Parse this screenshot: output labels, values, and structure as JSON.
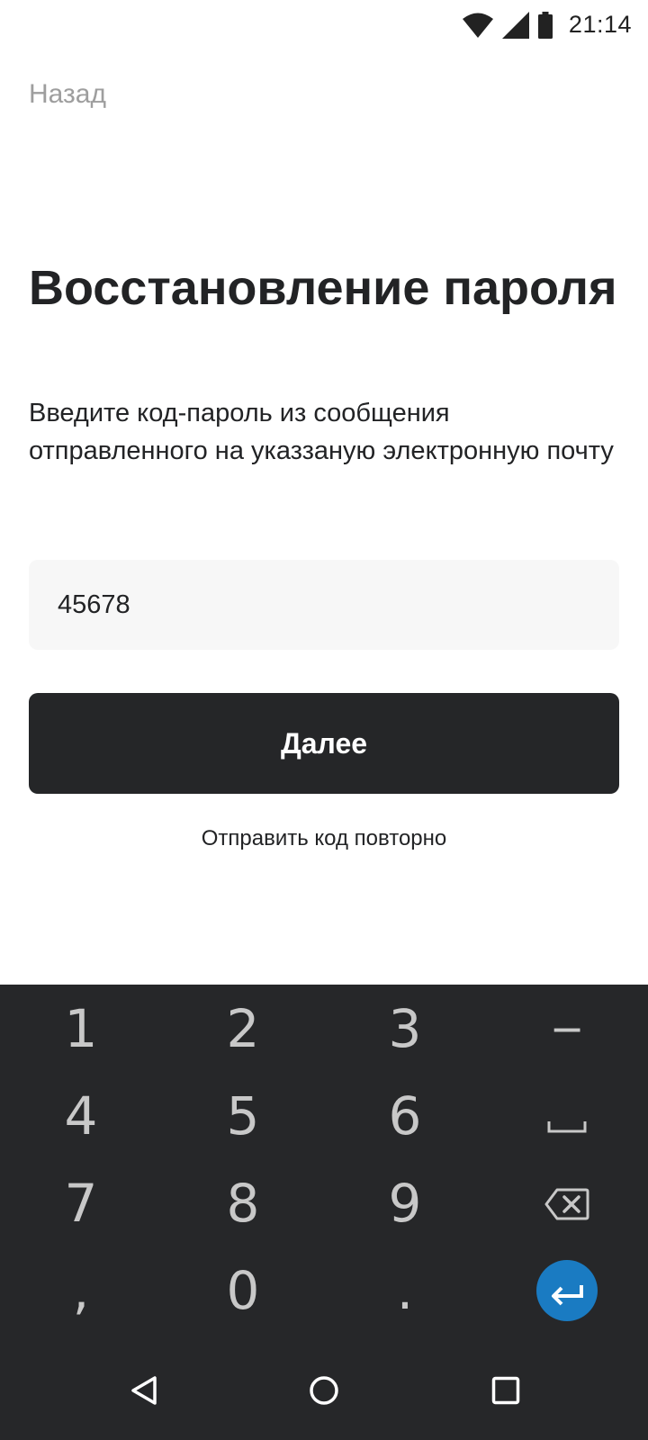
{
  "status_bar": {
    "time": "21:14",
    "icons": [
      "wifi-icon",
      "cellular-signal-icon",
      "battery-icon"
    ]
  },
  "header": {
    "back_label": "Назад"
  },
  "main": {
    "title": "Восстановление пароля",
    "subtitle": "Введите код-пароль из сообщения отправленного на указзаную электронную почту",
    "code_input": {
      "value": "45678",
      "placeholder": ""
    },
    "next_button_label": "Далее",
    "resend_label": "Отправить код повторно"
  },
  "keyboard": {
    "keys": {
      "k1": "1",
      "k2": "2",
      "k3": "3",
      "minus": "−",
      "k4": "4",
      "k5": "5",
      "k6": "6",
      "space": "␣",
      "k7": "7",
      "k8": "8",
      "k9": "9",
      "comma": ",",
      "k0": "0",
      "dot": "."
    },
    "special_icons": [
      "backspace-icon",
      "enter-icon"
    ],
    "accent_color": "#1a7bc2"
  },
  "nav_bar": {
    "icons": [
      "back-triangle-icon",
      "home-circle-icon",
      "recents-square-icon"
    ]
  },
  "colors": {
    "background": "#ffffff",
    "text": "#222325",
    "muted": "#9e9e9e",
    "button": "#252628",
    "keyboard": "#262729",
    "input_bg": "#f7f7f7"
  }
}
